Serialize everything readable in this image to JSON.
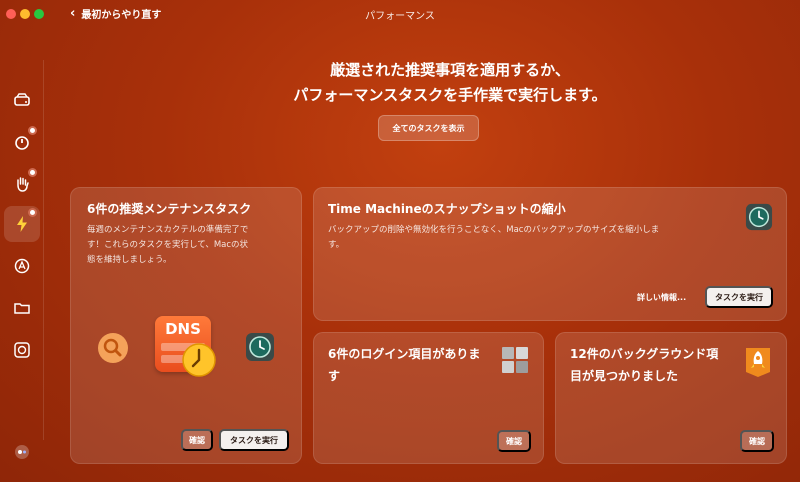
{
  "window": {
    "title": "パフォーマンス",
    "back_label": "最初からやり直す"
  },
  "sidebar": {
    "items": [
      {
        "name": "sidebar-item-cleanup",
        "icon": "disk-icon"
      },
      {
        "name": "sidebar-item-protection",
        "icon": "shield-icon"
      },
      {
        "name": "sidebar-item-privacy",
        "icon": "hand-icon"
      },
      {
        "name": "sidebar-item-performance",
        "icon": "bolt-icon",
        "active": true
      },
      {
        "name": "sidebar-item-applications",
        "icon": "app-icon"
      },
      {
        "name": "sidebar-item-files",
        "icon": "folder-icon"
      },
      {
        "name": "sidebar-item-space",
        "icon": "lens-icon"
      }
    ]
  },
  "hero": {
    "line1": "厳選された推奨事項を適用するか、",
    "line2": "パフォーマンスタスクを手作業で実行します。",
    "show_all": "全てのタスクを表示"
  },
  "maintenance": {
    "title": "6件の推奨メンテナンスタスク",
    "desc1": "毎週のメンテナンスカクテルの準備完了で",
    "desc2": "す！これらのタスクを実行して、Macの状",
    "desc3": "態を維持しましょう。",
    "dns_label": "DNS",
    "review": "確認",
    "run": "タスクを実行"
  },
  "timemachine": {
    "title": "Time Machineのスナップショットの縮小",
    "desc1": "バックアップの削除や無効化を行うことなく、Macのバックアップのサイズを縮小しま",
    "desc2": "す。",
    "more": "詳しい情報...",
    "run": "タスクを実行"
  },
  "login": {
    "title1": "6件のログイン項目がありま",
    "title2": "す",
    "review": "確認"
  },
  "background": {
    "title1": "12件のバックグラウンド項",
    "title2": "目が見つかりました",
    "review": "確認"
  },
  "colors": {
    "accent": "#b5350c",
    "badge": "#ffffff"
  }
}
